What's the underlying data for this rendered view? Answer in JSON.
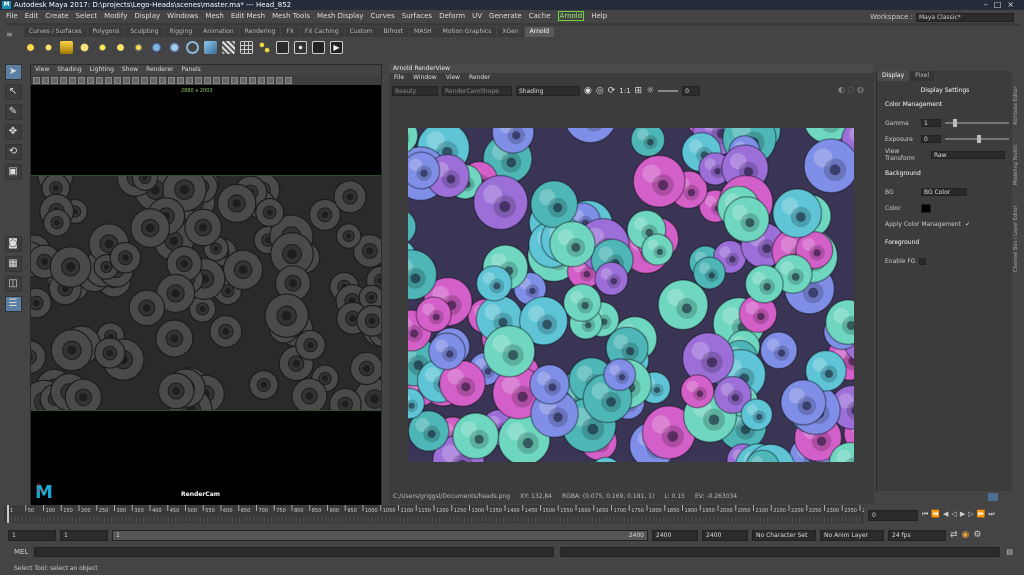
{
  "window": {
    "title": "Autodesk Maya 2017: D:\\projects\\Lego-Heads\\scenes\\master.ma*   ---   Head_852",
    "logo": "M"
  },
  "menubar": {
    "items": [
      "File",
      "Edit",
      "Create",
      "Select",
      "Modify",
      "Display",
      "Windows",
      "Mesh",
      "Edit Mesh",
      "Mesh Tools",
      "Mesh Display",
      "Curves",
      "Surfaces",
      "Deform",
      "UV",
      "Generate",
      "Cache"
    ],
    "arnold": "Arnold",
    "help": "Help"
  },
  "workspace": {
    "label": "Workspace :",
    "value": "Maya Classic*"
  },
  "shelf": {
    "tabs": [
      "Curves / Surfaces",
      "Polygons",
      "Sculpting",
      "Rigging",
      "Animation",
      "Rendering",
      "FX",
      "FX Caching",
      "Custom",
      "Bifrost",
      "MASH",
      "Motion Graphics",
      "XGen",
      "Arnold"
    ],
    "active_tab": "Arnold"
  },
  "viewport": {
    "menu": [
      "View",
      "Shading",
      "Lighting",
      "Show",
      "Renderer",
      "Panels"
    ],
    "resolution": "2880 x 2003",
    "camera": "RenderCam"
  },
  "renderview": {
    "title": "Arnold RenderView",
    "menu": [
      "File",
      "Window",
      "View",
      "Render"
    ],
    "dropdowns": [
      "Beauty",
      "RenderCamShape",
      "Shading"
    ],
    "ratio": "1:1",
    "exposure_value": "0",
    "status": {
      "path": "C:/Users/griggsl/Documents/heads.png",
      "xy": "XY: 132,84",
      "rgba": "RGBA: (0.075, 0.169, 0.181, 1)",
      "l": "L: 0.15",
      "ev": "EV: -0.263034"
    }
  },
  "display_panel": {
    "tabs": [
      "Display",
      "Pixel"
    ],
    "heading": "Display Settings",
    "color_management": "Color Management",
    "gamma_label": "Gamma",
    "gamma": "1",
    "exposure_label": "Exposure",
    "exposure": "0",
    "view_transform_label": "View Transform",
    "view_transform": "Raw",
    "background": "Background",
    "bg_label": "BG",
    "bg_value": "BG Color",
    "color_label": "Color",
    "apply_cm": "Apply Color Management",
    "foreground": "Foreground",
    "enable_fg": "Enable FG"
  },
  "sidetabs": [
    "Channel Box / Layer Editor",
    "Modeling Toolkit",
    "Attribute Editor"
  ],
  "timeline": {
    "ticks": [
      "1",
      "50",
      "100",
      "150",
      "200",
      "250",
      "300",
      "350",
      "400",
      "450",
      "500",
      "550",
      "600",
      "650",
      "700",
      "750",
      "800",
      "850",
      "900",
      "950",
      "1000",
      "1050",
      "1100",
      "1150",
      "1200",
      "1250",
      "1300",
      "1350",
      "1400",
      "1450",
      "1500",
      "1550",
      "1600",
      "1650",
      "1700",
      "1750",
      "1800",
      "1850",
      "1900",
      "1950",
      "2000",
      "2050",
      "2100",
      "2150",
      "2200",
      "2250",
      "2300",
      "2350",
      "2400"
    ],
    "current_frame": "0"
  },
  "range": {
    "start": "1",
    "start_inner": "1",
    "slider_start": "1",
    "slider_end": "2400",
    "end_inner": "2400",
    "end": "2400",
    "character_set": "No Character Set",
    "anim_layer": "No Anim Layer",
    "fps": "24 fps"
  },
  "command": {
    "label": "MEL"
  },
  "help_line": "Select Tool: select an object",
  "colors": {
    "pink": "#d35fc8",
    "purple": "#9c6fd8",
    "teal": "#4fb6b8",
    "mint": "#6fd6c0",
    "accent": "#5a7fa3",
    "arnold_green": "#6fd33f"
  }
}
